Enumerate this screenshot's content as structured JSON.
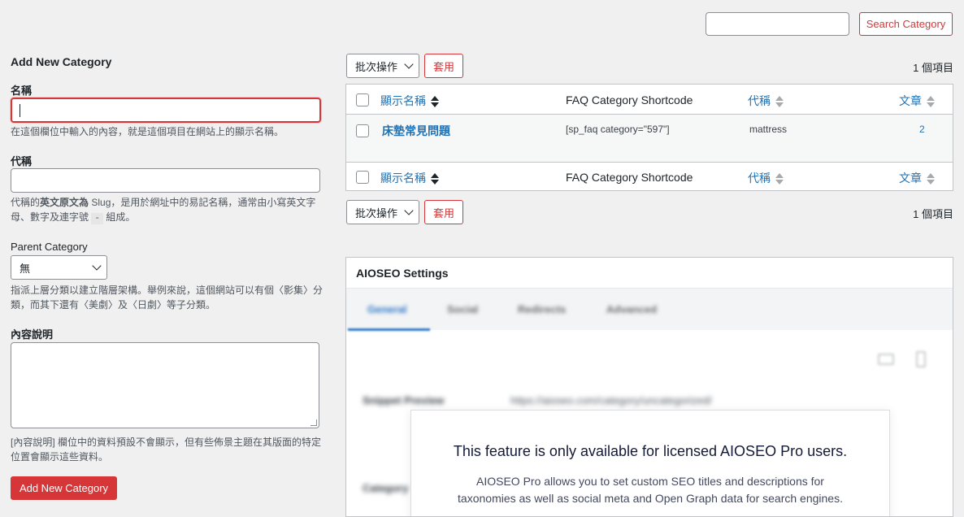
{
  "search": {
    "placeholder": "",
    "button_label": "Search Category"
  },
  "form": {
    "title": "Add New Category",
    "name_label": "名稱",
    "name_help": "在這個欄位中輸入的內容，就是這個項目在網站上的顯示名稱。",
    "slug_label": "代稱",
    "slug_help_pre": "代稱的",
    "slug_help_bold": "英文原文為",
    "slug_help_mid": " Slug，是用於網址中的易記名稱，通常由小寫英文字母、數字及連字號",
    "slug_help_code": "-",
    "slug_help_post": "組成。",
    "parent_label": "Parent Category",
    "parent_value": "無",
    "parent_help": "指派上層分類以建立階層架構。舉例來說，這個網站可以有個〈影集〉分類，而其下還有〈美劇〉及〈日劇〉等子分類。",
    "desc_label": "內容說明",
    "desc_help": "[內容說明] 欄位中的資料預設不會顯示，但有些佈景主題在其版面的特定位置會顯示這些資料。",
    "submit_label": "Add New Category"
  },
  "bulk": {
    "select_label": "批次操作",
    "apply_label": "套用",
    "items_count": "1 個項目"
  },
  "table": {
    "headers": {
      "name": "顯示名稱",
      "shortcode": "FAQ Category Shortcode",
      "slug": "代稱",
      "count": "文章"
    },
    "rows": [
      {
        "name": "床墊常見問題",
        "shortcode": "[sp_faq category=\"597\"]",
        "slug": "mattress",
        "count": "2"
      }
    ]
  },
  "aioseo": {
    "title": "AIOSEO Settings",
    "tabs": [
      "General",
      "Social",
      "Redirects",
      "Advanced"
    ],
    "snippet_label": "Snippet Preview",
    "snippet_url": "https://aioseo.com/category/uncategorized/",
    "category_label": "Category",
    "modal_title": "This feature is only available for licensed AIOSEO Pro users.",
    "modal_body_1": "AIOSEO Pro allows you to set custom SEO titles and descriptions for",
    "modal_body_2": "taxonomies as well as social meta and Open Graph data for search engines."
  },
  "colors": {
    "accent_red": "#d63638",
    "link_blue": "#2271b1",
    "aioseo_blue": "#2c76c7"
  }
}
